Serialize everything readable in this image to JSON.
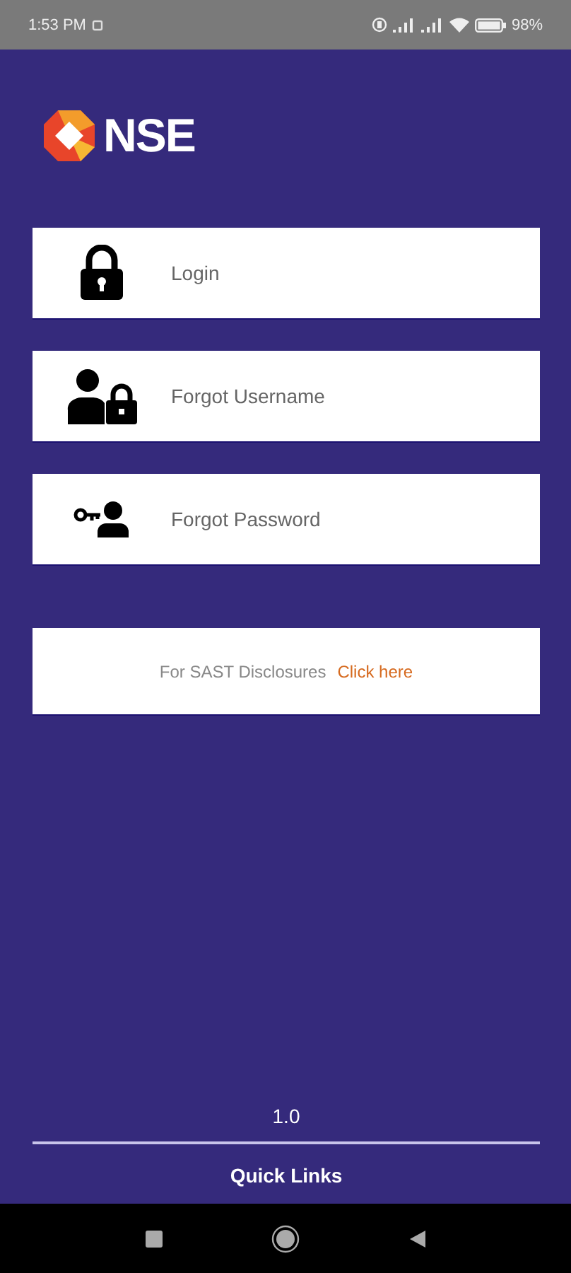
{
  "status_bar": {
    "time": "1:53 PM",
    "battery": "98%"
  },
  "logo": {
    "text": "NSE"
  },
  "menu": [
    {
      "kind": "lock",
      "label": "Login"
    },
    {
      "kind": "user-lock",
      "label": "Forgot Username"
    },
    {
      "kind": "key-user",
      "label": "Forgot Password"
    }
  ],
  "sast": {
    "text": "For SAST Disclosures",
    "link": "Click here"
  },
  "version": "1.0",
  "footer": {
    "quick_links": "Quick Links"
  }
}
